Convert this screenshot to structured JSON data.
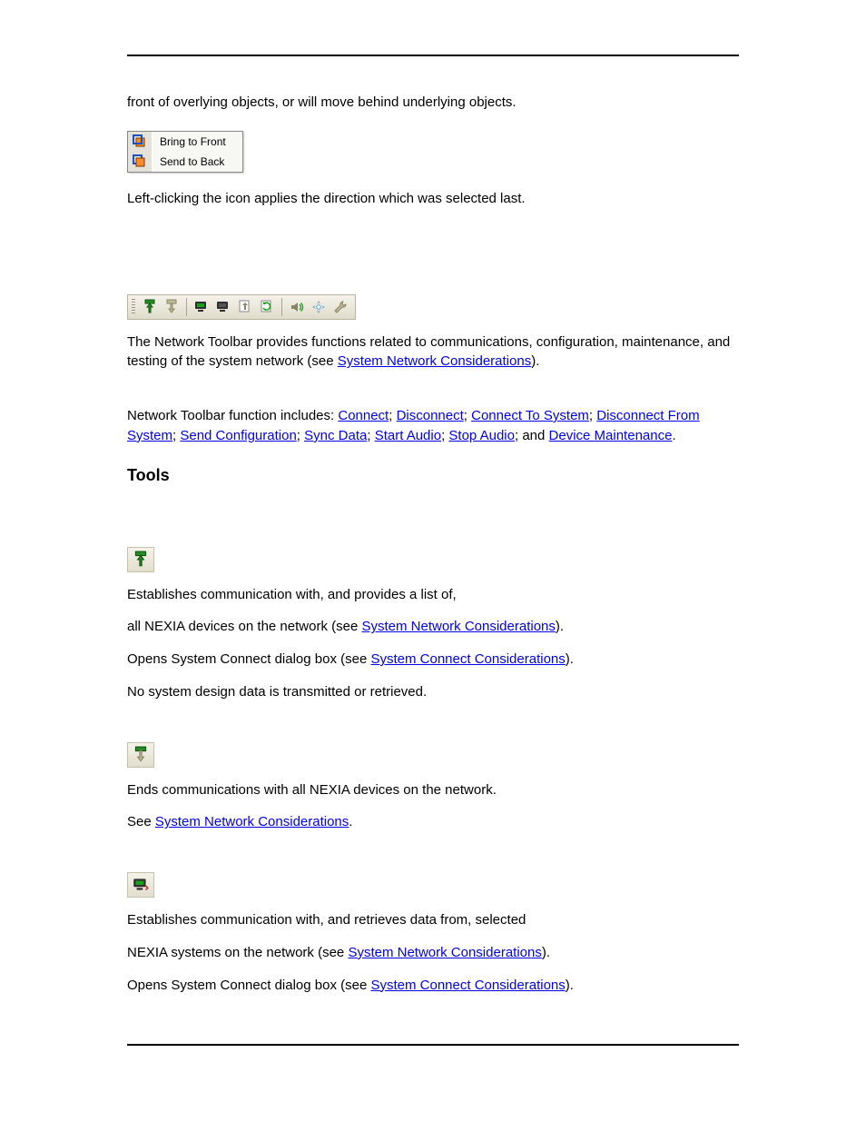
{
  "intro": {
    "p1": "front of overlying objects, or will move behind underlying objects.",
    "menu": {
      "bring": "Bring to Front",
      "send": "Send to Back"
    },
    "p2": "Left-clicking the icon applies the direction which was selected last."
  },
  "network_toolbar": {
    "p1a": "The Network Toolbar provides functions related to communications, configuration, maintenance, and testing of the system network (see ",
    "p1link": "System Network Considerations",
    "p1b": ").",
    "funcs_pre": "Network Toolbar function includes: ",
    "links": {
      "connect": "Connect",
      "disconnect": "Disconnect",
      "connect_to_system": "Connect To System",
      "disconnect_from_system": "Disconnect From System",
      "send_config": "Send Configuration",
      "sync_data": "Sync Data",
      "start_audio": "Start Audio",
      "stop_audio": "Stop Audio",
      "device_maint": "Device Maintenance"
    },
    "sep": "; ",
    "and": "and ",
    "period": "."
  },
  "tools_heading": "Tools",
  "connect": {
    "l1": "Establishes communication with, and provides a list of,",
    "l2a": "all NEXIA devices on the network (see ",
    "l2link": "System Network Considerations",
    "l2b": ").",
    "l3a": "Opens System Connect dialog box (see ",
    "l3link": "System Connect Considerations",
    "l3b": ").",
    "l4": "No system design data is transmitted or retrieved."
  },
  "disconnect": {
    "l1": "Ends communications with all NEXIA devices on the network.",
    "l2a": "See ",
    "l2link": "System Network Considerations",
    "l2b": "."
  },
  "connect_system": {
    "l1": "Establishes communication with, and retrieves data from, selected",
    "l2a": "NEXIA systems on the network (see ",
    "l2link": "System Network Considerations",
    "l2b": ").",
    "l3a": "Opens System Connect dialog box (see ",
    "l3link": "System Connect Considerations",
    "l3b": ")."
  }
}
